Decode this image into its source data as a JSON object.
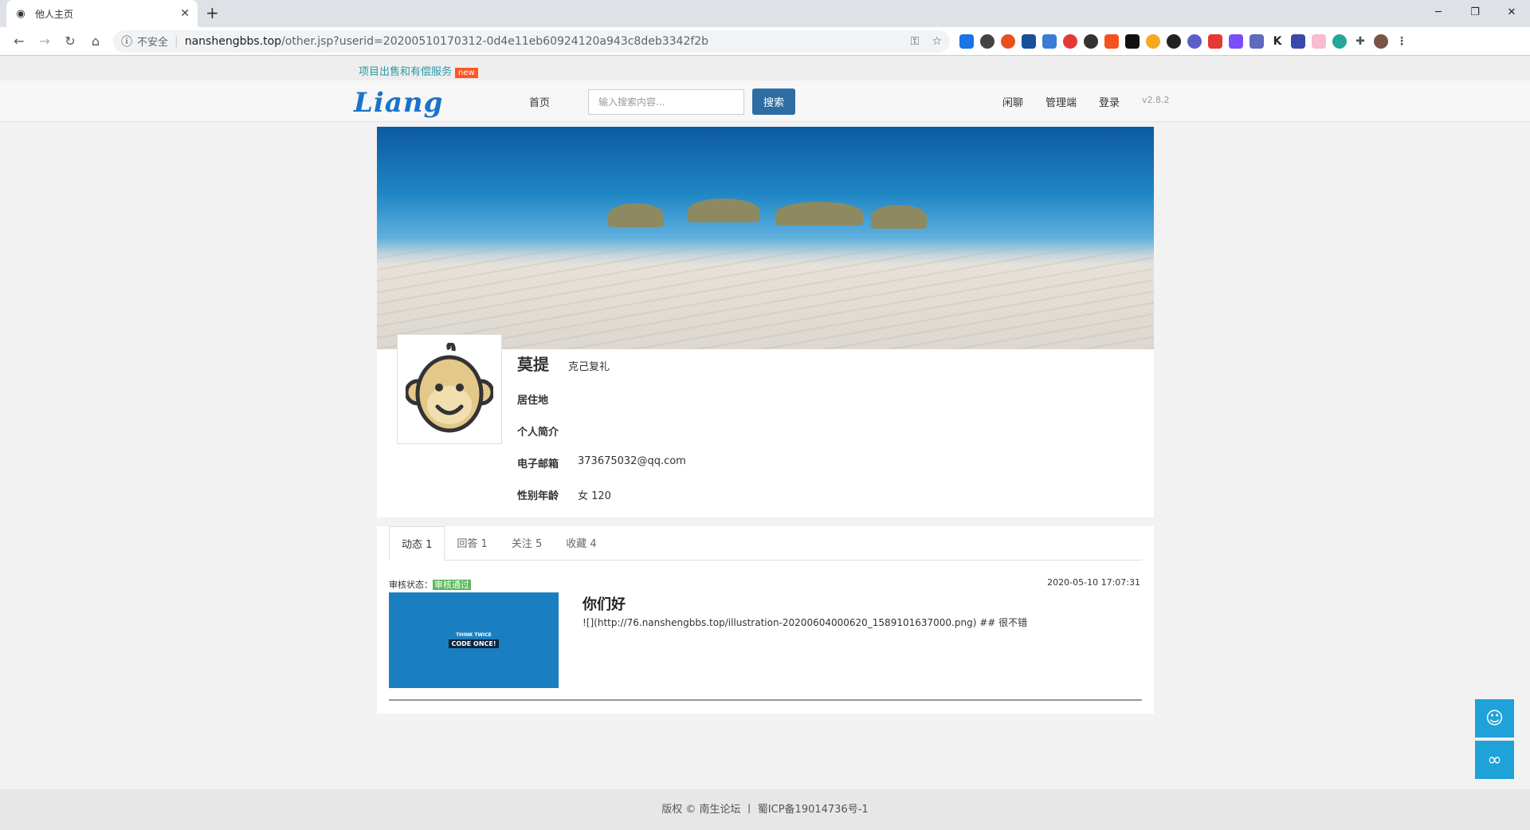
{
  "browser": {
    "tab_title": "他人主页",
    "url_host": "nanshengbbs.top",
    "url_path": "/other.jsp?userid=20200510170312-0d4e11eb60924120a943c8deb3342f2b",
    "insecure_label": "不安全"
  },
  "promo": {
    "text": "项目出售和有偿服务",
    "badge": "new"
  },
  "header": {
    "logo": "Liang",
    "home": "首页",
    "search_placeholder": "输入搜索内容...",
    "search_button": "搜索",
    "links": [
      "闲聊",
      "管理端",
      "登录"
    ],
    "version": "v2.8.2"
  },
  "profile": {
    "name": "莫提",
    "motto": "克己复礼",
    "fields": [
      {
        "label": "居住地",
        "value": ""
      },
      {
        "label": "个人简介",
        "value": ""
      },
      {
        "label": "电子邮箱",
        "value": "373675032@qq.com"
      },
      {
        "label": "性别年龄",
        "value": "女 120"
      }
    ]
  },
  "tabs": [
    {
      "label": "动态 1",
      "active": true
    },
    {
      "label": "回答 1",
      "active": false
    },
    {
      "label": "关注 5",
      "active": false
    },
    {
      "label": "收藏 4",
      "active": false
    }
  ],
  "post": {
    "audit_label": "审核状态：",
    "audit_status": "审核通过",
    "thumb_line1": "THINK TWICE",
    "thumb_line2": "CODE ONCE!",
    "title": "你们好",
    "body": "![](http://76.nanshengbbs.top/illustration-20200604000620_1589101637000.png) ## 很不错",
    "date": "2020-05-10 17:07:31"
  },
  "footer": {
    "text": "版权 © 南生论坛 丨 蜀ICP备19014736号-1"
  },
  "colors": {
    "accent": "#2e6da4",
    "brand_blue": "#1a73c8",
    "float_button": "#1ea2d8",
    "audit_ok": "#5cb85c"
  }
}
